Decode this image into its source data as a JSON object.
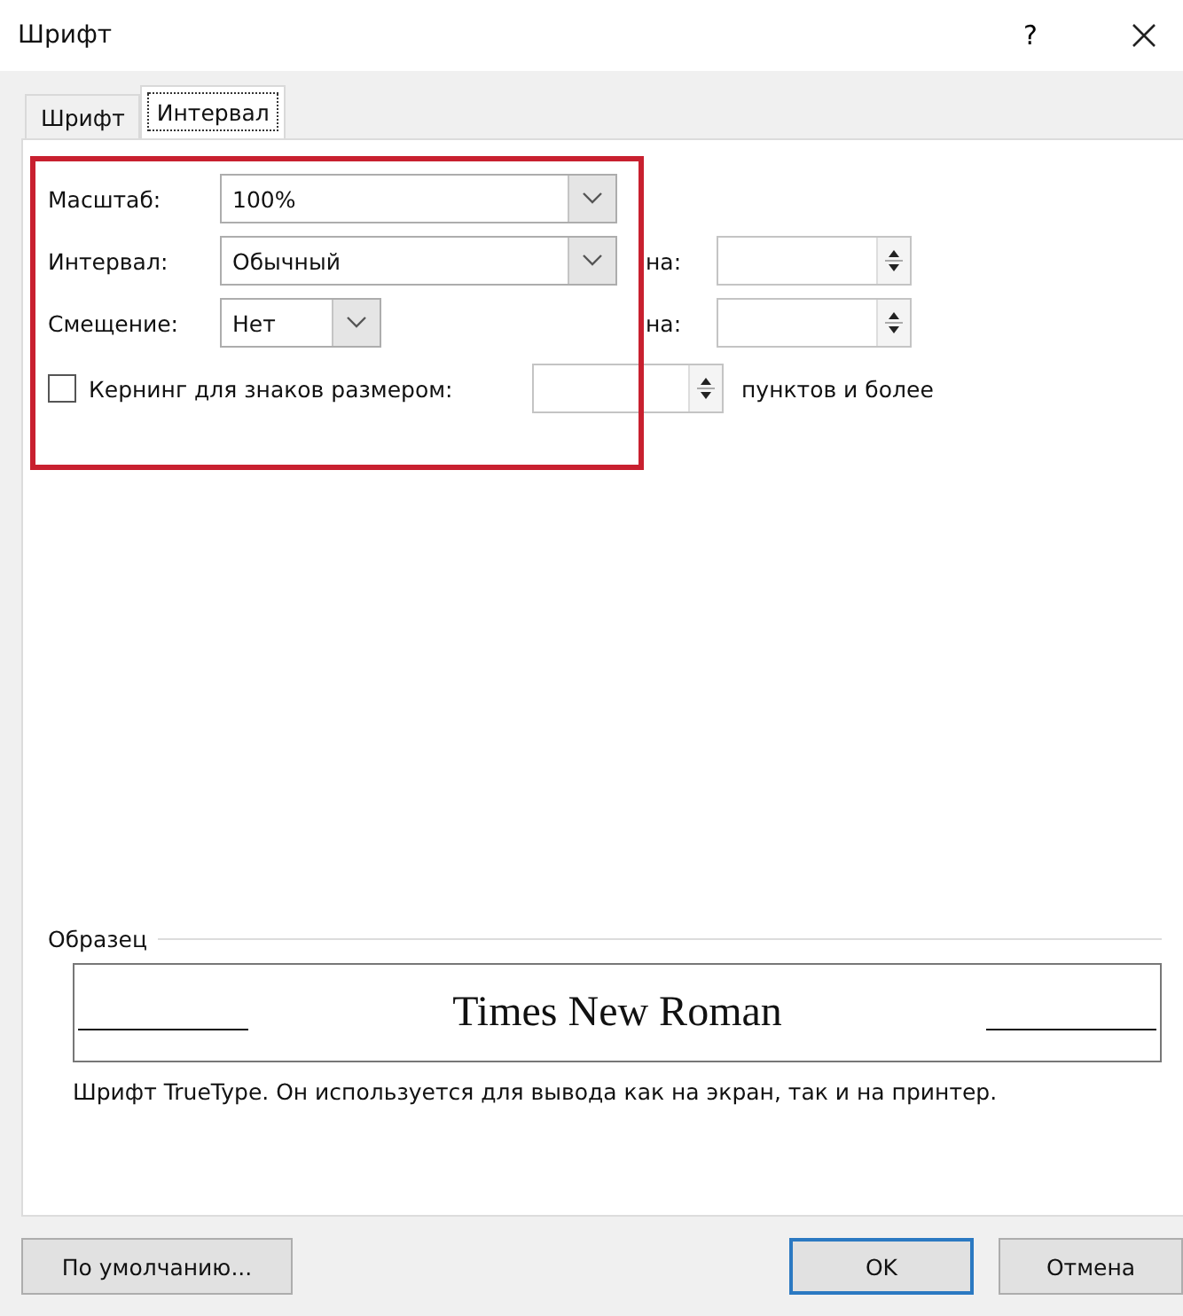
{
  "window": {
    "title": "Шрифт",
    "help": "?"
  },
  "tabs": [
    {
      "label": "Шрифт",
      "selected": false
    },
    {
      "label": "Интервал",
      "selected": true
    }
  ],
  "scale": {
    "label": "Масштаб:",
    "value": "100%"
  },
  "spacing": {
    "label": "Интервал:",
    "value": "Обычный",
    "by_label": "на:"
  },
  "position": {
    "label": "Смещение:",
    "value": "Нет",
    "by_label": "на:"
  },
  "kerning": {
    "label": "Кернинг для знаков размером:",
    "checked": false,
    "suffix": "пунктов и более"
  },
  "preview": {
    "legend": "Образец",
    "sample": "Times New Roman",
    "description": "Шрифт TrueType. Он используется для вывода как на экран, так и на принтер."
  },
  "annotation": {
    "kind": "frame"
  },
  "buttons": [
    {
      "label": "По умолчанию...",
      "default": false
    },
    {
      "label": "OK",
      "default": true
    },
    {
      "label": "Отмена",
      "default": false
    }
  ]
}
